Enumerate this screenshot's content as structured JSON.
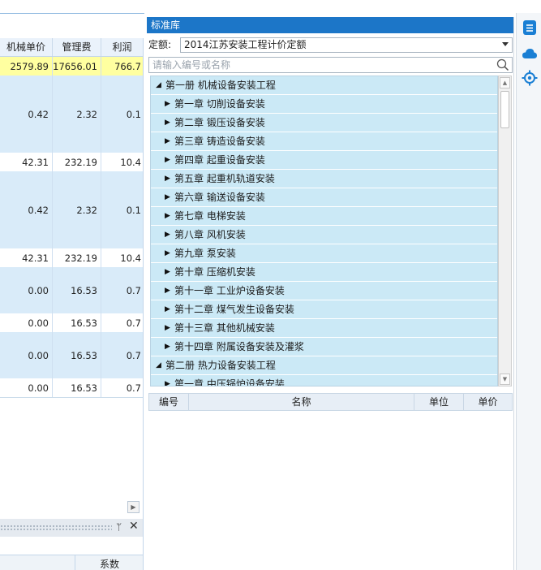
{
  "grid": {
    "headers": [
      "机械单价",
      "管理费",
      "利润"
    ],
    "rows": [
      {
        "machine": "2579.89",
        "mgmt": "17656.01",
        "profit": "766.7",
        "style": "summary"
      },
      {
        "machine": "0.42",
        "mgmt": "2.32",
        "profit": "0.1",
        "style": "tall"
      },
      {
        "machine": "42.31",
        "mgmt": "232.19",
        "profit": "10.4",
        "style": "plain"
      },
      {
        "machine": "0.42",
        "mgmt": "2.32",
        "profit": "0.1",
        "style": "tall"
      },
      {
        "machine": "42.31",
        "mgmt": "232.19",
        "profit": "10.4",
        "style": "plain"
      },
      {
        "machine": "0.00",
        "mgmt": "16.53",
        "profit": "0.7",
        "style": "mid"
      },
      {
        "machine": "0.00",
        "mgmt": "16.53",
        "profit": "0.7",
        "style": "plain"
      },
      {
        "machine": "0.00",
        "mgmt": "16.53",
        "profit": "0.7",
        "style": "mid"
      },
      {
        "machine": "0.00",
        "mgmt": "16.53",
        "profit": "0.7",
        "style": "plain"
      }
    ],
    "bottom_header": "系数"
  },
  "library": {
    "title": "标准库",
    "quota_label": "定额:",
    "quota_value": "2014江苏安装工程计价定额",
    "search_placeholder": "请输入编号或名称",
    "tree": [
      {
        "label": "第一册 机械设备安装工程",
        "level": 0,
        "expanded": true
      },
      {
        "label": "第一章 切削设备安装",
        "level": 1,
        "expanded": false
      },
      {
        "label": "第二章 锻压设备安装",
        "level": 1,
        "expanded": false
      },
      {
        "label": "第三章 铸造设备安装",
        "level": 1,
        "expanded": false
      },
      {
        "label": "第四章 起重设备安装",
        "level": 1,
        "expanded": false
      },
      {
        "label": "第五章 起重机轨道安装",
        "level": 1,
        "expanded": false
      },
      {
        "label": "第六章 输送设备安装",
        "level": 1,
        "expanded": false
      },
      {
        "label": "第七章 电梯安装",
        "level": 1,
        "expanded": false
      },
      {
        "label": "第八章 风机安装",
        "level": 1,
        "expanded": false
      },
      {
        "label": "第九章 泵安装",
        "level": 1,
        "expanded": false
      },
      {
        "label": "第十章 压缩机安装",
        "level": 1,
        "expanded": false
      },
      {
        "label": "第十一章 工业炉设备安装",
        "level": 1,
        "expanded": false
      },
      {
        "label": "第十二章 煤气发生设备安装",
        "level": 1,
        "expanded": false
      },
      {
        "label": "第十三章 其他机械安装",
        "level": 1,
        "expanded": false
      },
      {
        "label": "第十四章 附属设备安装及灌浆",
        "level": 1,
        "expanded": false
      },
      {
        "label": "第二册 热力设备安装工程",
        "level": 0,
        "expanded": true
      },
      {
        "label": "第一章 中压锅炉设备安装",
        "level": 1,
        "expanded": false
      }
    ],
    "result_columns": [
      "编号",
      "名称",
      "单位",
      "单价"
    ]
  },
  "colors": {
    "title_bar": "#1c76c8",
    "tree_bg": "#cbe9f6",
    "summary_row": "#ffffa0",
    "light_blue_row": "#d9ebf9",
    "icon_blue": "#1a7fd4"
  },
  "icons": {
    "panel_pin": "pin-icon",
    "panel_close": "close-icon",
    "toolbar": [
      "document-list-icon",
      "cloud-icon",
      "locate-target-icon"
    ]
  }
}
